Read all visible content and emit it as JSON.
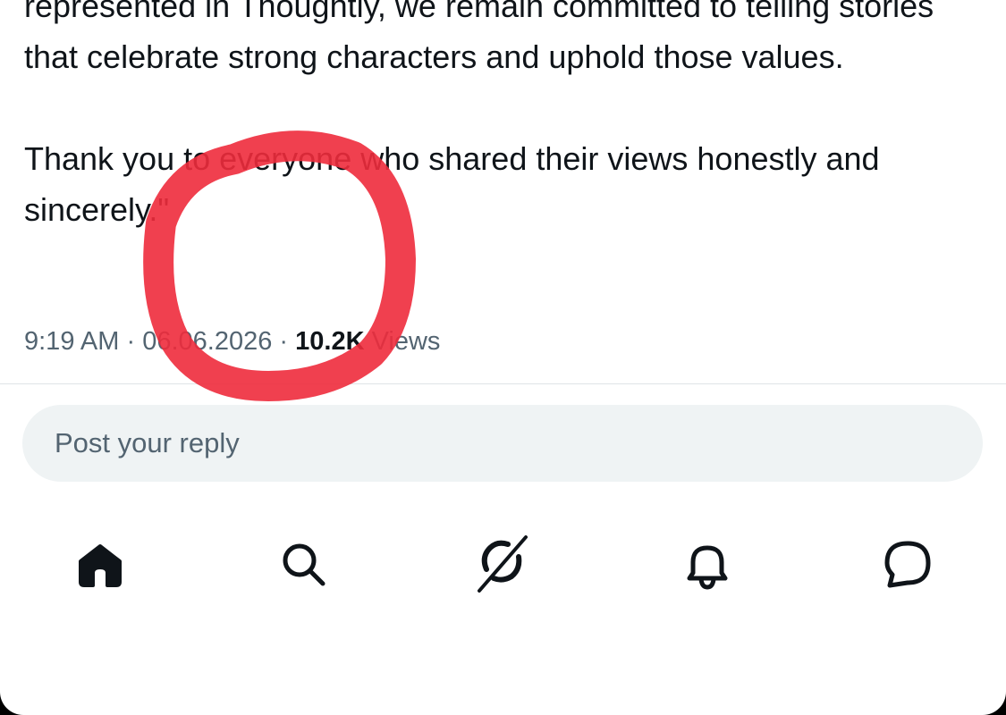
{
  "post": {
    "paragraphs": [
      "represented in Thoughtly, we remain committed to telling stories that celebrate strong characters and uphold those values.",
      "Thank you to everyone who shared their views honestly and sincerely.\""
    ],
    "meta": {
      "time": "9:19 AM",
      "separator": " · ",
      "date": "06.06.2026",
      "views_count": "10.2K",
      "views_label": " Views"
    }
  },
  "reply": {
    "placeholder": "Post your reply"
  },
  "tabbar": {
    "items": [
      {
        "name": "home",
        "icon": "home-icon",
        "active": true
      },
      {
        "name": "search",
        "icon": "search-icon",
        "active": false
      },
      {
        "name": "grok",
        "icon": "grok-icon",
        "active": false
      },
      {
        "name": "notifications",
        "icon": "bell-icon",
        "active": false
      },
      {
        "name": "messages",
        "icon": "message-icon",
        "active": false
      }
    ]
  },
  "annotation": {
    "type": "hand-drawn circle",
    "color": "#ee2b3c"
  },
  "colors": {
    "text_primary": "#0f1419",
    "text_secondary": "#536471",
    "reply_bg": "#eff3f4",
    "divider": "#dfe3e6"
  }
}
